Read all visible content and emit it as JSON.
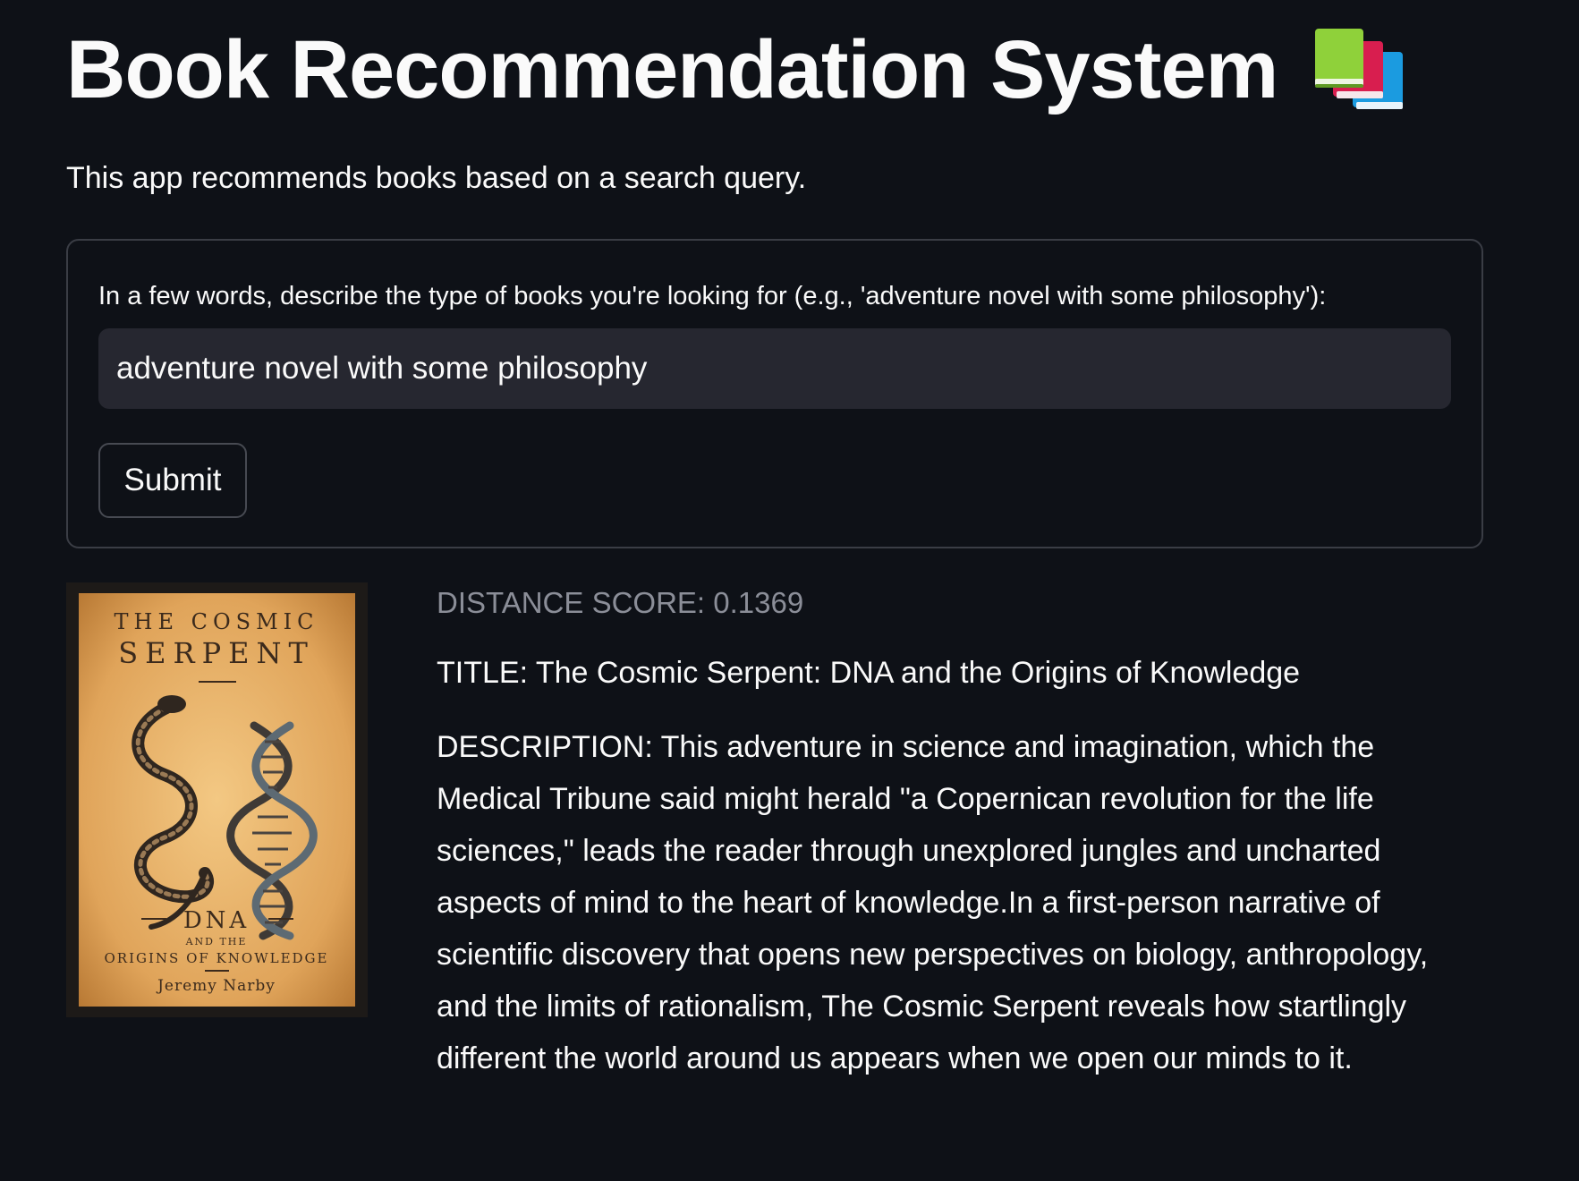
{
  "header": {
    "title": "Book Recommendation System",
    "icon": "books-icon",
    "subtitle": "This app recommends books based on a search query."
  },
  "form": {
    "label": "In a few words, describe the type of books you're looking for (e.g., 'adventure novel with some philosophy'):",
    "query_value": "adventure novel with some philosophy",
    "submit_label": "Submit"
  },
  "result": {
    "cover": {
      "line1": "THE COSMIC",
      "line2": "SERPENT",
      "line3": "DNA",
      "line4": "AND THE",
      "line5": "ORIGINS OF KNOWLEDGE",
      "author": "Jeremy Narby"
    },
    "score": "DISTANCE SCORE: 0.1369",
    "title": "TITLE: The Cosmic Serpent: DNA and the Origins of Knowledge",
    "description": "DESCRIPTION: This adventure in science and imagination, which the Medical Tribune said might herald \"a Copernican revolution for the life sciences,\" leads the reader through unexplored jungles and uncharted aspects of mind to the heart of knowledge.In a first-person narrative of scientific discovery that opens new perspectives on biology, anthropology, and the limits of rationalism, The Cosmic Serpent reveals how startlingly different the world around us appears when we open our minds to it."
  },
  "colors": {
    "background": "#0e1117",
    "input_background": "#262730",
    "muted_text": "#8b8e98",
    "cover_background": "#e8b26a"
  }
}
